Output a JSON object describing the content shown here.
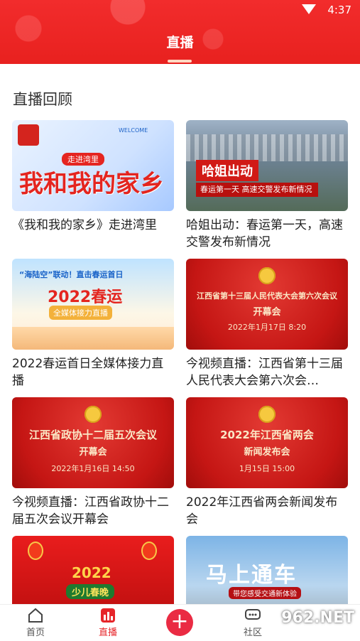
{
  "status_bar": {
    "time": "4:37",
    "wifi_icon": "wifi-icon"
  },
  "header": {
    "title": "直播"
  },
  "section": {
    "title": "直播回顾"
  },
  "cards": [
    {
      "caption": "《我和我的家乡》走进湾里",
      "thumb": {
        "main": "我和我的家乡",
        "sub": "走进湾里",
        "corner": "WELCOME"
      }
    },
    {
      "caption": "哈姐出动：春运第一天，高速交警发布新情况",
      "thumb": {
        "main": "哈姐出动",
        "sub": "春运第一天 高速交警发布新情况"
      }
    },
    {
      "caption": "2022春运首日全媒体接力直播",
      "thumb": {
        "main": "2022春运",
        "sub": "“海陆空”联动！直击春运首日",
        "sub2": "全媒体接力直播"
      }
    },
    {
      "caption": "今视频直播：江西省第十三届人民代表大会第六次会…",
      "thumb": {
        "main": "江西省第十三届人民代表大会第六次会议",
        "sub": "开幕会",
        "date": "2022年1月17日 8:20"
      }
    },
    {
      "caption": "今视频直播：江西省政协十二届五次会议开幕会",
      "thumb": {
        "main": "江西省政协十二届五次会议",
        "sub": "开幕会",
        "date": "2022年1月16日 14:50"
      }
    },
    {
      "caption": "2022年江西省两会新闻发布会",
      "thumb": {
        "main": "2022年江西省两会",
        "sub": "新闻发布会",
        "date": "1月15日 15:00"
      }
    },
    {
      "caption": "",
      "thumb": {
        "main": "2022",
        "sub": "少儿春晚"
      }
    },
    {
      "caption": "",
      "thumb": {
        "main": "马上通车",
        "sub": "带您感受交通新体验"
      }
    }
  ],
  "nav": {
    "home": "首页",
    "live": "直播",
    "community": "社区",
    "plus": "+"
  },
  "watermark": "962.NET"
}
